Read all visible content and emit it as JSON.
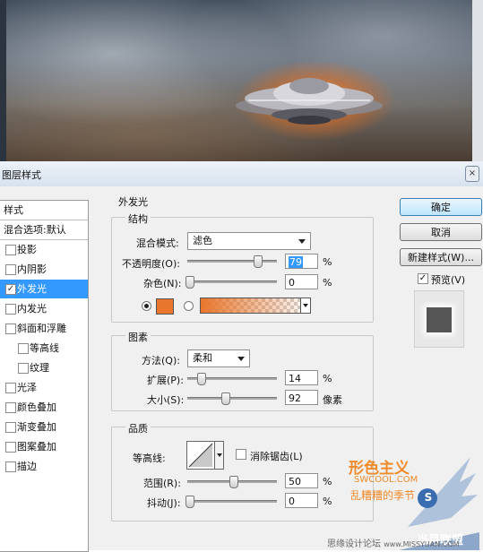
{
  "dialog": {
    "title": "图层样式",
    "close_label": "×"
  },
  "left_list": {
    "header": "样式",
    "blend_default": "混合选项:默认",
    "items": [
      {
        "label": "投影",
        "checked": false
      },
      {
        "label": "内阴影",
        "checked": false
      },
      {
        "label": "外发光",
        "checked": true,
        "selected": true
      },
      {
        "label": "内发光",
        "checked": false
      },
      {
        "label": "斜面和浮雕",
        "checked": false
      },
      {
        "label": "等高线",
        "checked": false,
        "indent": true
      },
      {
        "label": "纹理",
        "checked": false,
        "indent": true
      },
      {
        "label": "光泽",
        "checked": false
      },
      {
        "label": "颜色叠加",
        "checked": false
      },
      {
        "label": "渐变叠加",
        "checked": false
      },
      {
        "label": "图案叠加",
        "checked": false
      },
      {
        "label": "描边",
        "checked": false
      }
    ],
    "check_mark": "✓"
  },
  "outer_glow": {
    "title": "外发光",
    "structure": {
      "title": "结构",
      "blend_mode_label": "混合模式:",
      "blend_mode_value": "滤色",
      "opacity_label": "不透明度(O):",
      "opacity_value": "79",
      "opacity_unit": "%",
      "noise_label": "杂色(N):",
      "noise_value": "0",
      "noise_unit": "%",
      "color": "#e8762c",
      "gradient_start": "#e8762c"
    },
    "elements": {
      "title": "图素",
      "method_label": "方法(Q):",
      "method_value": "柔和",
      "spread_label": "扩展(P):",
      "spread_value": "14",
      "spread_unit": "%",
      "size_label": "大小(S):",
      "size_value": "92",
      "size_unit": "像素"
    },
    "quality": {
      "title": "品质",
      "contour_label": "等高线:",
      "antialias_label": "消除锯齿(L)",
      "range_label": "范围(R):",
      "range_value": "50",
      "range_unit": "%",
      "jitter_label": "抖动(J):",
      "jitter_value": "0",
      "jitter_unit": "%"
    }
  },
  "buttons": {
    "ok": "确定",
    "cancel": "取消",
    "new_style": "新建样式(W)...",
    "preview_label": "预览(V)",
    "preview_checked": true
  },
  "watermark": {
    "brand": "形色主义",
    "site": "SWCOOL.COM",
    "slogan": "乱糟糟的季节",
    "forum": "思缘设计论坛",
    "url": "www.MISSYUAN.COM",
    "badge": "S",
    "alliance": "当月联盟"
  },
  "colors": {
    "glow": "#e8762c",
    "selection": "#3399ff"
  }
}
